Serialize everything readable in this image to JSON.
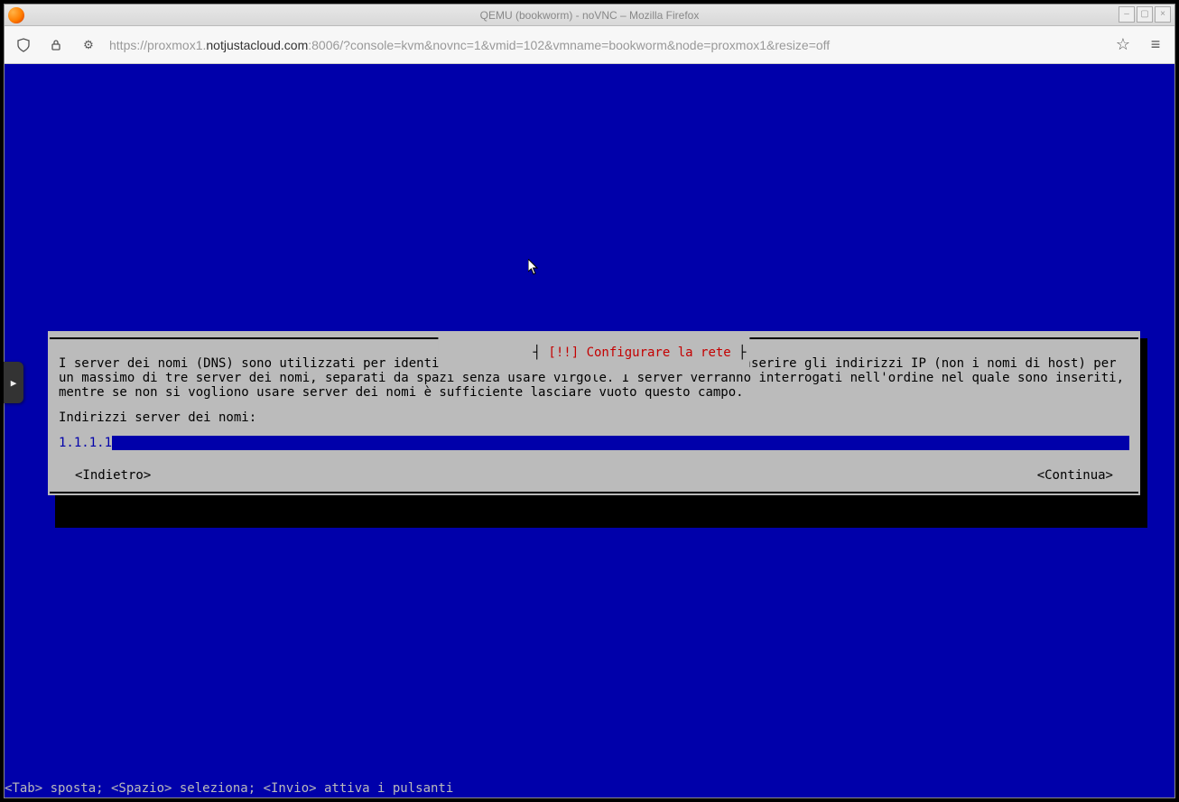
{
  "window": {
    "title": "QEMU (bookworm) - noVNC – Mozilla Firefox"
  },
  "addressbar": {
    "protocol": "https://",
    "host_weak_prefix": "proxmox1.",
    "host_strong": "notjustacloud.com",
    "rest": ":8006/?console=kvm&novnc=1&vmid=102&vmname=bookworm&node=proxmox1&resize=off"
  },
  "installer": {
    "dialog_title": "Configurare la rete",
    "bang": "[!!]",
    "description": "I server dei nomi (DNS) sono utilizzati per identificare un host all'interno della rete. Inserire gli indirizzi IP (non i nomi di host) per un massimo di tre server dei nomi, separati da spazi senza usare virgole. I server verranno interrogati nell'ordine nel quale sono inseriti, mentre se non si vogliono usare server dei nomi è sufficiente lasciare vuoto questo campo.",
    "field_label": "Indirizzi server dei nomi:",
    "field_value": "1.1.1.1",
    "back_label": "<Indietro>",
    "continue_label": "<Continua>",
    "help_bar": "<Tab> sposta; <Spazio> seleziona; <Invio> attiva i pulsanti"
  },
  "novnc": {
    "toggle_symbol": "▶"
  }
}
